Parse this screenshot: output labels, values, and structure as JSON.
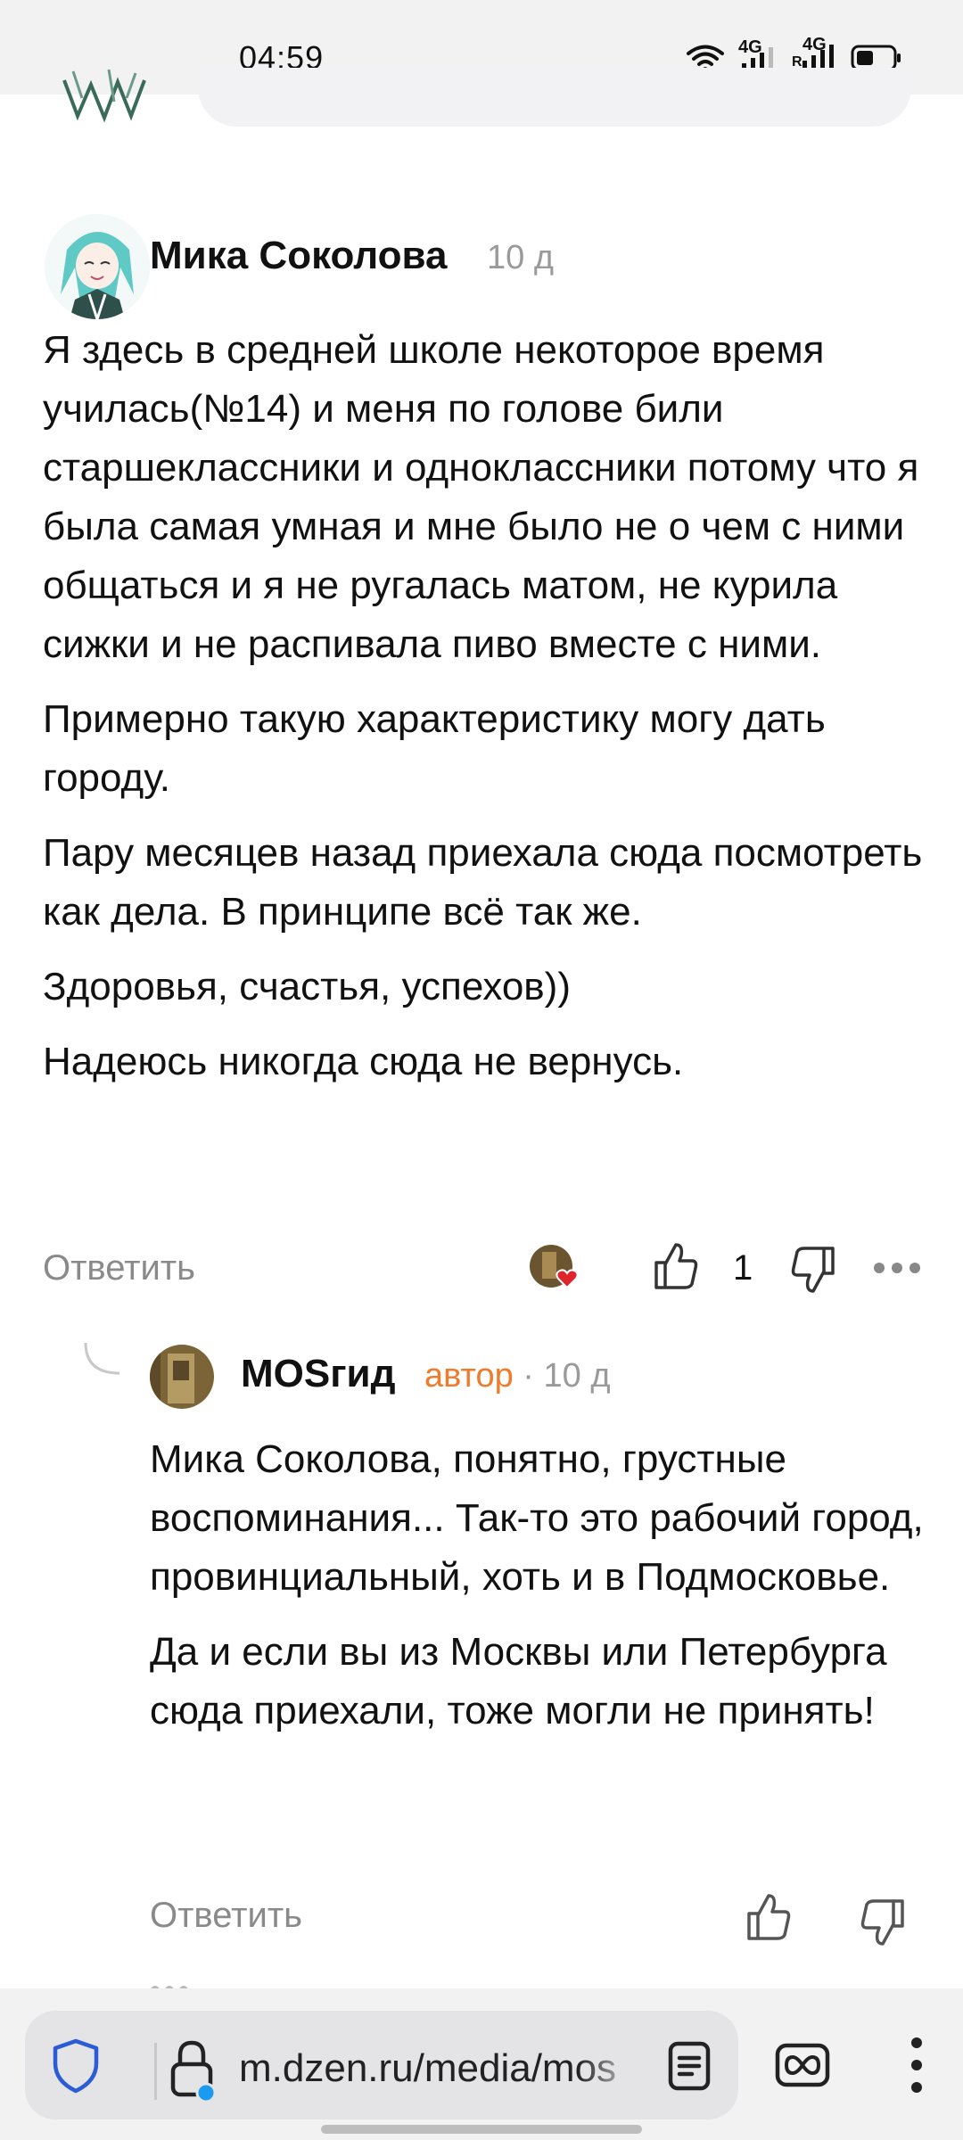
{
  "status_bar": {
    "time": "04:59",
    "sim1_label": "4G",
    "sim2_label": "4G",
    "sim2_roaming": "R"
  },
  "comment": {
    "author": "Мика Соколова",
    "age": "10 д",
    "paragraphs": [
      "Я здесь в средней школе некоторое время училась(№14) и меня по голове били старшеклассники и одноклассники потому что я была самая умная и мне было не о чем с ними общаться и я не ругалась матом, не курила сижки и не распивала пиво вместе с ними.",
      "Примерно такую характеристику могу дать городу.",
      "Пару месяцев назад приехала сюда посмотреть как дела. В принципе всё так же.",
      "Здоровья, счастья, успехов))",
      "Надеюсь никогда сюда не вернусь."
    ],
    "reply_label": "Ответить",
    "likes": "1"
  },
  "reply": {
    "author": "MOSгид",
    "badge": "автор",
    "separator": "·",
    "age": "10 д",
    "paragraphs": [
      "Мика Соколова, понятно, грустные воспоминания... Так-то это рабочий город, провинциальный, хоть и в Подмосковье.",
      "Да и если вы из Москвы или Петербурга сюда приехали, тоже могли не принять!"
    ],
    "reply_label": "Ответить"
  },
  "browser": {
    "url": "m.dzen.ru/media/mos"
  },
  "colors": {
    "accent_orange": "#f07b2a",
    "like_heart": "#e0242c",
    "secure_dot": "#1a9bf0"
  }
}
